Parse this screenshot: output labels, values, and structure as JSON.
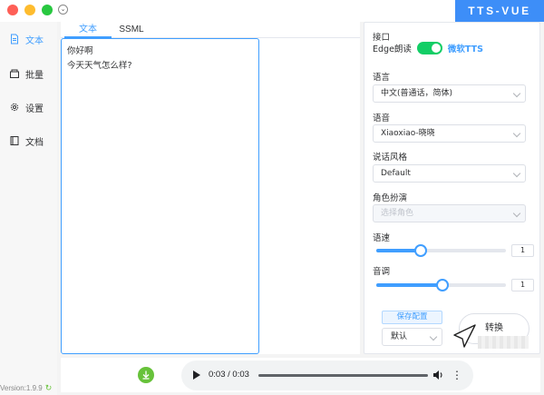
{
  "window": {
    "brand": "TTS-VUE"
  },
  "sidebar": {
    "items": [
      {
        "label": "文本",
        "icon": "document-icon",
        "active": true
      },
      {
        "label": "批量",
        "icon": "batch-icon",
        "active": false
      },
      {
        "label": "设置",
        "icon": "gear-icon",
        "active": false
      },
      {
        "label": "文档",
        "icon": "book-icon",
        "active": false
      }
    ],
    "version": "Version:1.9.9"
  },
  "editor": {
    "tabs": [
      {
        "label": "文本",
        "active": true
      },
      {
        "label": "SSML",
        "active": false
      }
    ],
    "text": "你好啊\n今天天气怎么样?"
  },
  "panel": {
    "interface_label": "接口",
    "switch_left": "Edge朗读",
    "switch_right": "微软TTS",
    "switch_on": true,
    "language_label": "语言",
    "language_value": "中文(普通话，简体)",
    "voice_label": "语音",
    "voice_value": "Xiaoxiao-晓晓",
    "style_label": "说话风格",
    "style_value": "Default",
    "role_label": "角色扮演",
    "role_placeholder": "选择角色",
    "speed_label": "语速",
    "speed_value": "1",
    "speed_fraction": 0.34,
    "pitch_label": "音调",
    "pitch_value": "1",
    "pitch_fraction": 0.51,
    "save_label": "保存配置",
    "preset_value": "默认",
    "convert_label": "转换"
  },
  "player": {
    "time": "0:03 / 0:03"
  },
  "colors": {
    "accent": "#409eff",
    "brand": "#3d8ef8",
    "switch": "#13ce66",
    "download": "#67c23a"
  }
}
